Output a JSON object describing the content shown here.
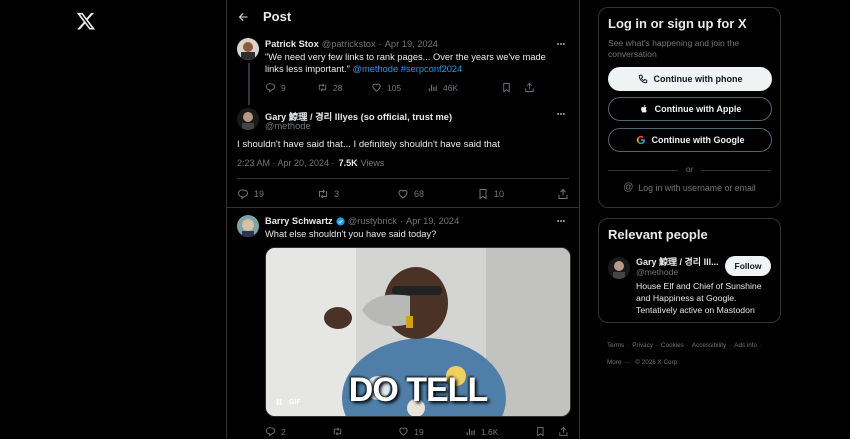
{
  "header": {
    "title": "Post"
  },
  "tweet1": {
    "name": "Patrick Stox",
    "handle": "@patrickstox",
    "sep": "·",
    "date": "Apr 19, 2024",
    "text": "\"We need very few links to rank pages... Over the years we've made links less important.\"",
    "mention": "@methode",
    "hashtag": "#serpconf2024",
    "replies": "9",
    "reposts": "28",
    "likes": "105",
    "views": "46K"
  },
  "main_post": {
    "name": "Gary 鯨理 / 경리 Illyes (so official, trust me)",
    "handle": "@methode",
    "text": "I shouldn't have said that... I definitely shouldn't have said that",
    "time": "2:23 AM · Apr 20, 2024 ·",
    "views_count": "7.5K",
    "views_label": "Views",
    "replies": "19",
    "reposts": "3",
    "likes": "68",
    "bookmarks": "10"
  },
  "tweet3": {
    "name": "Barry Schwartz",
    "handle": "@rustybrick",
    "sep": "·",
    "date": "Apr 19, 2024",
    "text": "What else shouldn't you have said today?",
    "gif_label": "GIF",
    "gif_caption": "DO TELL",
    "replies": "2",
    "likes": "19",
    "views": "1.6K"
  },
  "login_card": {
    "title": "Log in or sign up for X",
    "subtitle": "See what's happening and join the conversation",
    "phone_btn": "Continue with phone",
    "apple_btn": "Continue with Apple",
    "google_btn": "Continue with Google",
    "or": "or",
    "username_link": "Log in with username or email"
  },
  "relevant": {
    "title": "Relevant people",
    "name": "Gary 鯨理 / 경리 Ill...",
    "handle": "@methode",
    "follow": "Follow",
    "bio": "House Elf and Chief of Sunshine and Happiness at Google. Tentatively active on Mastodon"
  },
  "footer": {
    "line1": [
      "Terms",
      "Privacy",
      "Cookies",
      "Accessibility",
      "Ads info"
    ],
    "more": "More ···",
    "copyright": "© 2026 X Corp."
  },
  "colors": {
    "accent": "#1d9bf0",
    "muted": "#71767b",
    "border": "#2f3336"
  }
}
